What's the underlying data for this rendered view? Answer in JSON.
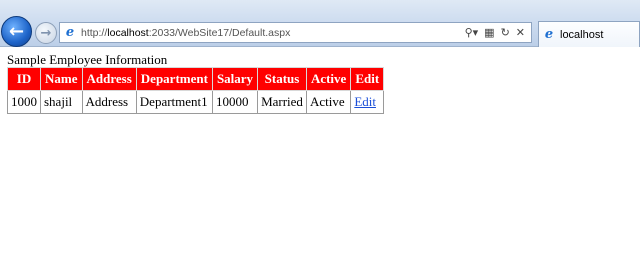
{
  "browser": {
    "url_prefix": "http://",
    "url_host": "localhost",
    "url_rest": ":2033/WebSite17/Default.aspx",
    "tab_title": "localhost"
  },
  "page": {
    "caption": "Sample Employee Information",
    "columns": [
      "ID",
      "Name",
      "Address",
      "Department",
      "Salary",
      "Status",
      "Active",
      "Edit"
    ],
    "rows": [
      {
        "id": "1000",
        "name": "shajil",
        "address": "Address",
        "department": "Department1",
        "salary": "10000",
        "status": "Married",
        "active": "Active",
        "edit": "Edit"
      }
    ]
  },
  "colors": {
    "header_bg": "#ff0000",
    "header_text": "#ffffff",
    "link": "#1a4ed8"
  }
}
